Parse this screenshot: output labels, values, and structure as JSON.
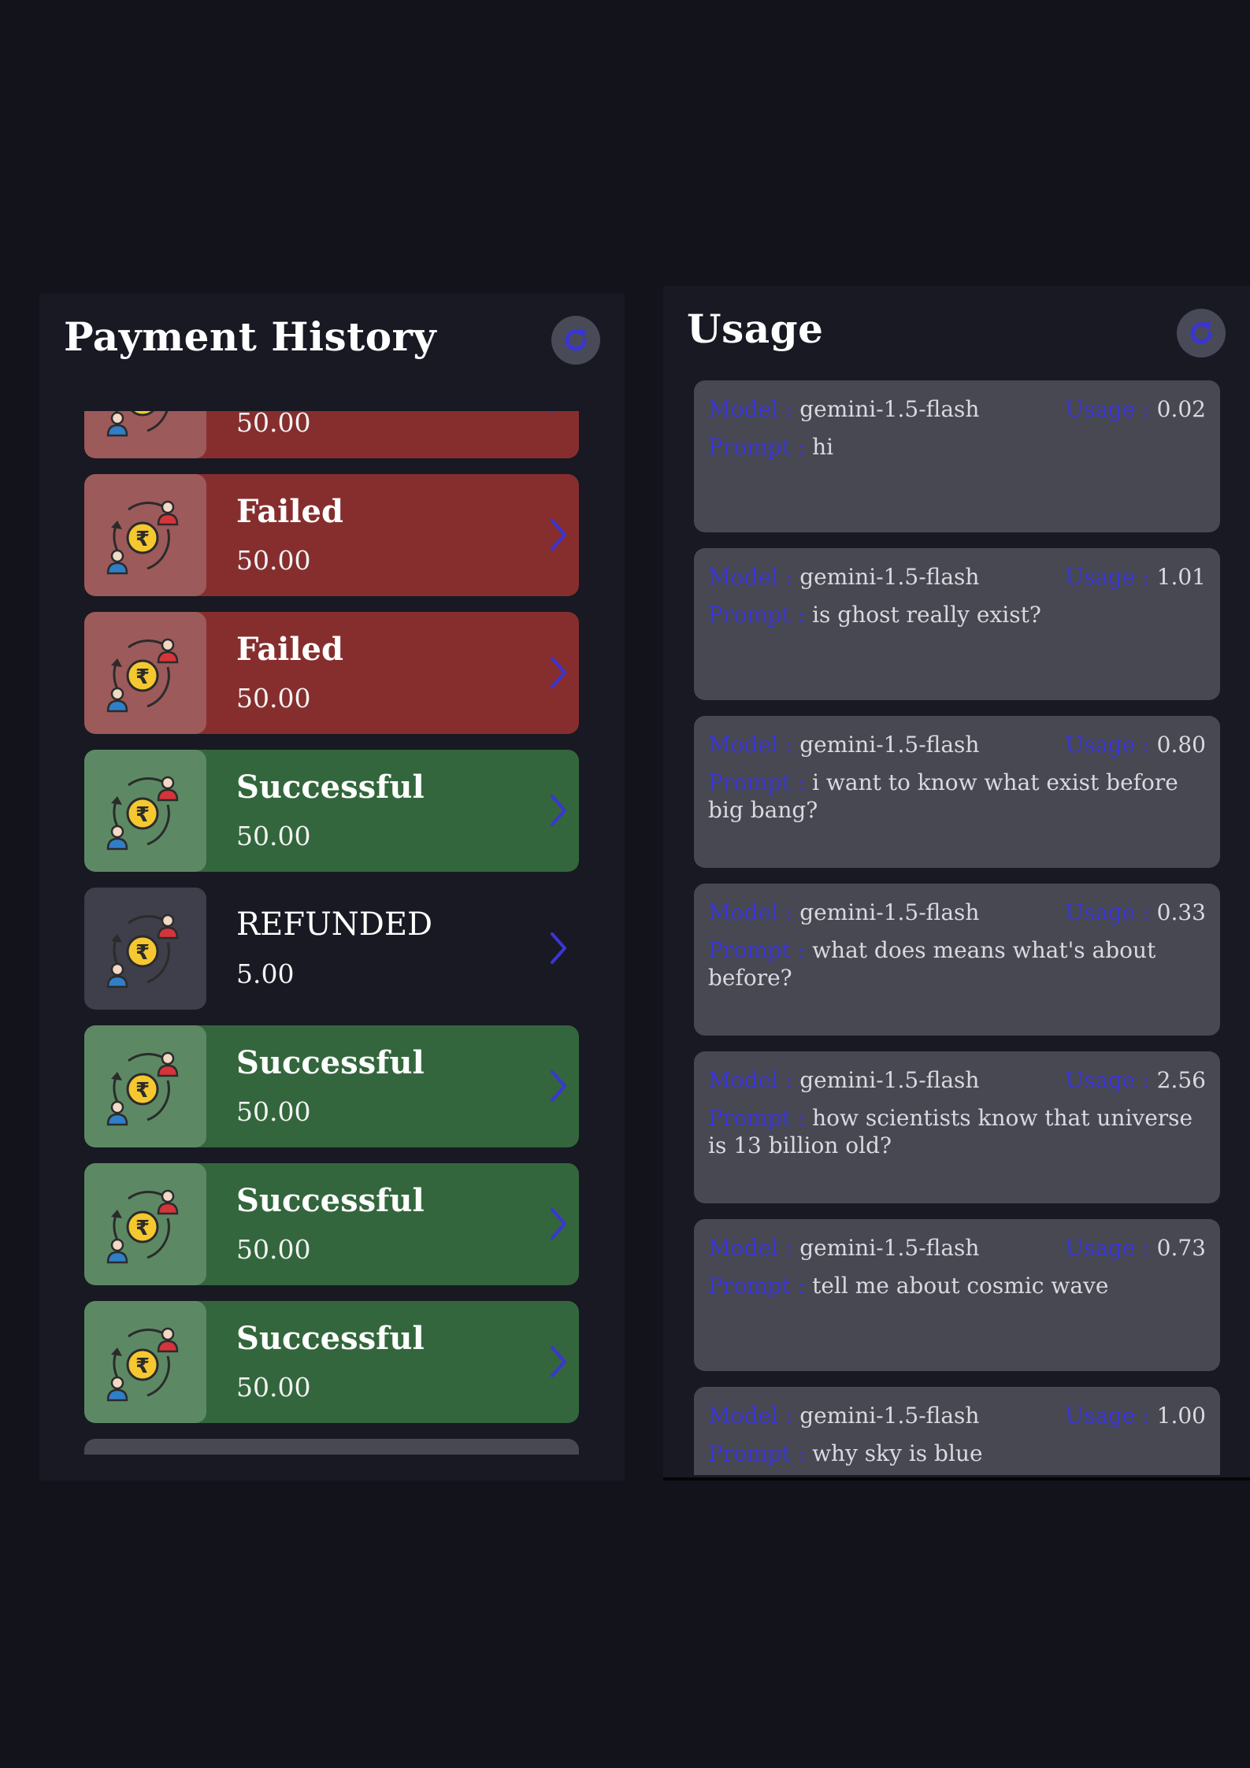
{
  "payment_history": {
    "title": "Payment History",
    "refresh_icon": "refresh-icon",
    "items": [
      {
        "status": "",
        "amount": "50.00",
        "type": "failed"
      },
      {
        "status": "Failed",
        "amount": "50.00",
        "type": "failed"
      },
      {
        "status": "Failed",
        "amount": "50.00",
        "type": "failed"
      },
      {
        "status": "Successful",
        "amount": "50.00",
        "type": "success"
      },
      {
        "status": "REFUNDED",
        "amount": "5.00",
        "type": "refunded"
      },
      {
        "status": "Successful",
        "amount": "50.00",
        "type": "success"
      },
      {
        "status": "Successful",
        "amount": "50.00",
        "type": "success"
      },
      {
        "status": "Successful",
        "amount": "50.00",
        "type": "success"
      },
      {
        "status": "",
        "amount": "",
        "type": "pending"
      }
    ]
  },
  "usage": {
    "title": "Usage",
    "refresh_icon": "refresh-icon",
    "model_label": "Model :",
    "usage_label": "Usage :",
    "prompt_label": "Prompt :",
    "items": [
      {
        "model": "gemini-1.5-flash",
        "usage": "0.02",
        "prompt": "hi"
      },
      {
        "model": "gemini-1.5-flash",
        "usage": "1.01",
        "prompt": "is ghost really exist?"
      },
      {
        "model": "gemini-1.5-flash",
        "usage": "0.80",
        "prompt": "i want to know what exist before big bang?"
      },
      {
        "model": "gemini-1.5-flash",
        "usage": "0.33",
        "prompt": "what does means what's about before?"
      },
      {
        "model": "gemini-1.5-flash",
        "usage": "2.56",
        "prompt": "how scientists know that universe is 13 billion old?"
      },
      {
        "model": "gemini-1.5-flash",
        "usage": "0.73",
        "prompt": "tell me about cosmic wave"
      },
      {
        "model": "gemini-1.5-flash",
        "usage": "1.00",
        "prompt": "why sky is blue"
      }
    ]
  },
  "colors": {
    "background": "#13141b",
    "panel": "#181923",
    "failed": "#862e2e",
    "success": "#33663c",
    "usage_card": "#474852",
    "accent": "#3b35d6"
  }
}
